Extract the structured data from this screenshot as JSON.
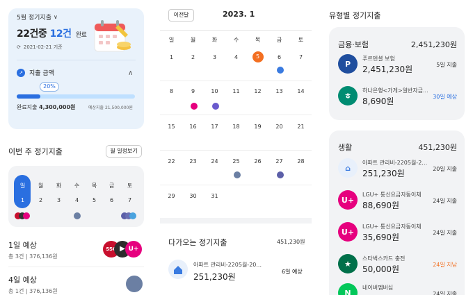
{
  "summary": {
    "month_label": "5월 정기지출",
    "total_count": "22건중",
    "done_count": "12건",
    "done_label": "완료",
    "base_date": "2021-02-21 기준",
    "amount_title": "지출 금액",
    "progress_pct_label": "20%",
    "progress_fraction": 0.2,
    "done_amount_label": "완료지출",
    "done_amount": "4,300,000원",
    "expected_amount": "예상지출 21,500,000원"
  },
  "week": {
    "title": "이번 주 정기지출",
    "month_view_button": "월 일정보기",
    "days": [
      "일",
      "월",
      "화",
      "수",
      "목",
      "금",
      "토"
    ],
    "dates": [
      "1",
      "2",
      "3",
      "4",
      "5",
      "6",
      "7"
    ]
  },
  "week_events": [
    {
      "title": "1일 예상",
      "count": "총 3건",
      "amount": "376,136원"
    },
    {
      "title": "4일 예상",
      "count": "총 1건",
      "amount": "376,136원"
    }
  ],
  "calendar": {
    "prev_button": "이전달",
    "title": "2023. 1",
    "weekdays": [
      "일",
      "월",
      "화",
      "수",
      "목",
      "금",
      "토"
    ],
    "weeks": [
      [
        "1",
        "2",
        "3",
        "4",
        "5",
        "6",
        "7"
      ],
      [
        "8",
        "9",
        "10",
        "11",
        "12",
        "13",
        "14"
      ],
      [
        "15",
        "16",
        "17",
        "18",
        "19",
        "20",
        "21"
      ],
      [
        "22",
        "23",
        "24",
        "25",
        "26",
        "27",
        "28"
      ],
      [
        "29",
        "30",
        "31"
      ]
    ],
    "today": "5"
  },
  "upcoming": {
    "title": "다가오는 정기지출",
    "total": "451,230원",
    "items": [
      {
        "name": "아파트 관리비-2205월-20...",
        "amount": "251,230원",
        "due": "6일 예상"
      }
    ]
  },
  "by_type": {
    "title": "유형별 정기지출",
    "categories": [
      {
        "name": "금융·보험",
        "total": "2,451,230원",
        "items": [
          {
            "name": "푸르덴셜 보험",
            "amount": "2,451,230원",
            "due": "5일 지출",
            "icon": "prudential-icon",
            "color": "#1f4e9e"
          },
          {
            "name": "하나은행<가게>일반자금...",
            "amount": "8,690원",
            "due": "30일 예상",
            "icon": "hana-bank-icon",
            "color": "#008c72"
          }
        ]
      },
      {
        "name": "생활",
        "total": "451,230원",
        "items": [
          {
            "name": "아파트 관리비-2205월-20...",
            "amount": "251,230원",
            "due": "20일 지출",
            "icon": "home-icon",
            "color": "#3a7be0"
          },
          {
            "name": "LGU+ 통신요금자동이체",
            "amount": "88,690원",
            "due": "24일 지출",
            "icon": "lgu-icon",
            "color": "#e6007e"
          },
          {
            "name": "LGU+ 통신요금자동이체",
            "amount": "35,690원",
            "due": "24일 지출",
            "icon": "lgu-icon",
            "color": "#e6007e"
          },
          {
            "name": "스타벅스카드 충전",
            "amount": "50,000원",
            "due": "24일 지남",
            "icon": "starbucks-icon",
            "color": "#00704a"
          },
          {
            "name": "네이버멤버십",
            "amount": "",
            "due": "24일 지출",
            "icon": "naver-icon",
            "color": "#03c75a"
          }
        ]
      }
    ]
  },
  "colors": {
    "accent": "#2a6fe0",
    "today": "#f36f21",
    "overdue": "#f36f21",
    "expected": "#2a6fe0"
  }
}
